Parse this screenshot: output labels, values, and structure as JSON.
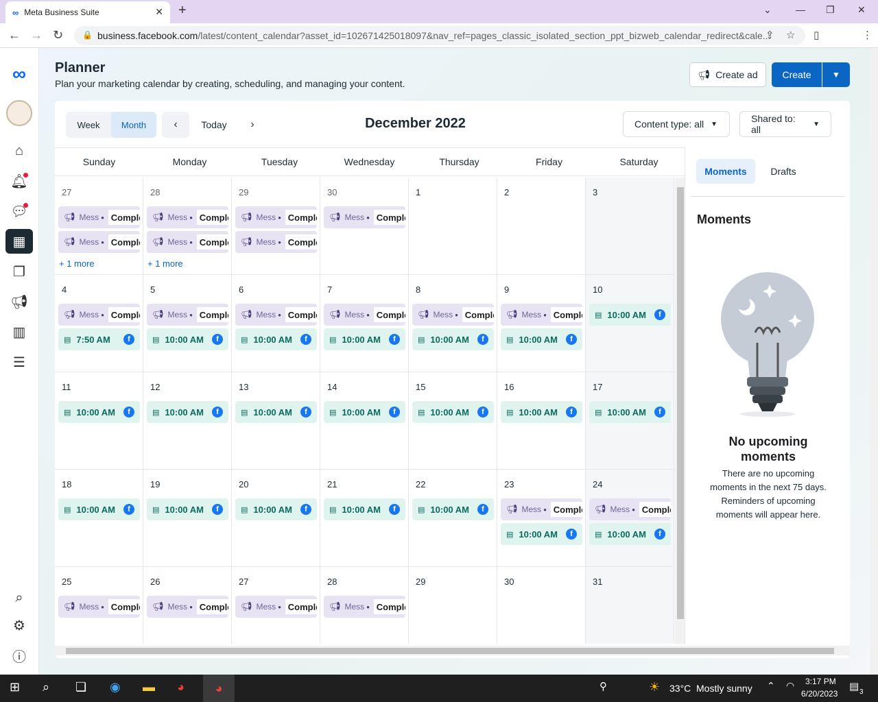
{
  "browser": {
    "tab_title": "Meta Business Suite",
    "url_domain": "business.facebook.com",
    "url_path": "/latest/content_calendar?asset_id=102671425018097&nav_ref=pages_classic_isolated_section_ppt_bizweb_calendar_redirect&cale..."
  },
  "header": {
    "title": "Planner",
    "subtitle": "Plan your marketing calendar by creating, scheduling, and managing your content.",
    "create_ad_label": "Create ad",
    "create_label": "Create"
  },
  "toolbar": {
    "week_label": "Week",
    "month_label": "Month",
    "today_label": "Today",
    "month_title": "December 2022",
    "content_type_label": "Content type: all",
    "shared_to_label": "Shared to: all"
  },
  "weekdays": [
    "Sunday",
    "Monday",
    "Tuesday",
    "Wednesday",
    "Thursday",
    "Friday",
    "Saturday"
  ],
  "weeks": [
    [
      {
        "day": "27",
        "out": true,
        "items": [
          {
            "type": "msg",
            "label": "Mess",
            "status": "Comple"
          },
          {
            "type": "msg",
            "label": "Mess",
            "status": "Comple"
          }
        ],
        "more": "+ 1 more"
      },
      {
        "day": "28",
        "out": true,
        "items": [
          {
            "type": "msg",
            "label": "Mess",
            "status": "Comple"
          },
          {
            "type": "msg",
            "label": "Mess",
            "status": "Comple"
          }
        ],
        "more": "+ 1 more"
      },
      {
        "day": "29",
        "out": true,
        "items": [
          {
            "type": "msg",
            "label": "Mess",
            "status": "Comple"
          },
          {
            "type": "msg",
            "label": "Mess",
            "status": "Comple"
          }
        ]
      },
      {
        "day": "30",
        "out": true,
        "items": [
          {
            "type": "msg",
            "label": "Mess",
            "status": "Comple"
          }
        ]
      },
      {
        "day": "1",
        "items": []
      },
      {
        "day": "2",
        "items": []
      },
      {
        "day": "3",
        "items": []
      }
    ],
    [
      {
        "day": "4",
        "items": [
          {
            "type": "msg",
            "label": "Mess",
            "status": "Comple"
          },
          {
            "type": "post",
            "time": "7:50 AM"
          }
        ]
      },
      {
        "day": "5",
        "items": [
          {
            "type": "msg",
            "label": "Mess",
            "status": "Comple"
          },
          {
            "type": "post",
            "time": "10:00 AM"
          }
        ]
      },
      {
        "day": "6",
        "items": [
          {
            "type": "msg",
            "label": "Mess",
            "status": "Comple"
          },
          {
            "type": "post",
            "time": "10:00 AM"
          }
        ]
      },
      {
        "day": "7",
        "items": [
          {
            "type": "msg",
            "label": "Mess",
            "status": "Comple"
          },
          {
            "type": "post",
            "time": "10:00 AM"
          }
        ]
      },
      {
        "day": "8",
        "items": [
          {
            "type": "msg",
            "label": "Mess",
            "status": "Comple"
          },
          {
            "type": "post",
            "time": "10:00 AM"
          }
        ]
      },
      {
        "day": "9",
        "items": [
          {
            "type": "msg",
            "label": "Mess",
            "status": "Comple"
          },
          {
            "type": "post",
            "time": "10:00 AM"
          }
        ]
      },
      {
        "day": "10",
        "items": [
          {
            "type": "post",
            "time": "10:00 AM"
          }
        ]
      }
    ],
    [
      {
        "day": "11",
        "items": [
          {
            "type": "post",
            "time": "10:00 AM"
          }
        ]
      },
      {
        "day": "12",
        "items": [
          {
            "type": "post",
            "time": "10:00 AM"
          }
        ]
      },
      {
        "day": "13",
        "items": [
          {
            "type": "post",
            "time": "10:00 AM"
          }
        ]
      },
      {
        "day": "14",
        "items": [
          {
            "type": "post",
            "time": "10:00 AM"
          }
        ]
      },
      {
        "day": "15",
        "items": [
          {
            "type": "post",
            "time": "10:00 AM"
          }
        ]
      },
      {
        "day": "16",
        "items": [
          {
            "type": "post",
            "time": "10:00 AM"
          }
        ]
      },
      {
        "day": "17",
        "items": [
          {
            "type": "post",
            "time": "10:00 AM"
          }
        ]
      }
    ],
    [
      {
        "day": "18",
        "items": [
          {
            "type": "post",
            "time": "10:00 AM"
          }
        ]
      },
      {
        "day": "19",
        "items": [
          {
            "type": "post",
            "time": "10:00 AM"
          }
        ]
      },
      {
        "day": "20",
        "items": [
          {
            "type": "post",
            "time": "10:00 AM"
          }
        ]
      },
      {
        "day": "21",
        "items": [
          {
            "type": "post",
            "time": "10:00 AM"
          }
        ]
      },
      {
        "day": "22",
        "items": [
          {
            "type": "post",
            "time": "10:00 AM"
          }
        ]
      },
      {
        "day": "23",
        "items": [
          {
            "type": "msg",
            "label": "Mess",
            "status": "Comple"
          },
          {
            "type": "post",
            "time": "10:00 AM"
          }
        ]
      },
      {
        "day": "24",
        "items": [
          {
            "type": "msg",
            "label": "Mess",
            "status": "Comple"
          },
          {
            "type": "post",
            "time": "10:00 AM"
          }
        ]
      }
    ],
    [
      {
        "day": "25",
        "items": [
          {
            "type": "msg",
            "label": "Mess",
            "status": "Comple"
          }
        ]
      },
      {
        "day": "26",
        "items": [
          {
            "type": "msg",
            "label": "Mess",
            "status": "Comple"
          }
        ]
      },
      {
        "day": "27",
        "items": [
          {
            "type": "msg",
            "label": "Mess",
            "status": "Comple"
          }
        ]
      },
      {
        "day": "28",
        "items": [
          {
            "type": "msg",
            "label": "Mess",
            "status": "Comple"
          }
        ]
      },
      {
        "day": "29",
        "items": []
      },
      {
        "day": "30",
        "items": []
      },
      {
        "day": "31",
        "items": []
      }
    ]
  ],
  "sidebar": {
    "tab_moments": "Moments",
    "tab_drafts": "Drafts",
    "title": "Moments",
    "empty_title": "No upcoming moments",
    "empty_desc": "There are no upcoming moments in the next 75 days. Reminders of upcoming moments will appear here."
  },
  "taskbar": {
    "temperature": "33°C",
    "weather": "Mostly sunny",
    "time": "3:17 PM",
    "date": "6/20/2023",
    "notifications": "3"
  },
  "colors": {
    "accent": "#0a66c2",
    "message_pill": "#e7e3f3",
    "post_pill": "#dff3ef",
    "facebook": "#1877f2"
  }
}
